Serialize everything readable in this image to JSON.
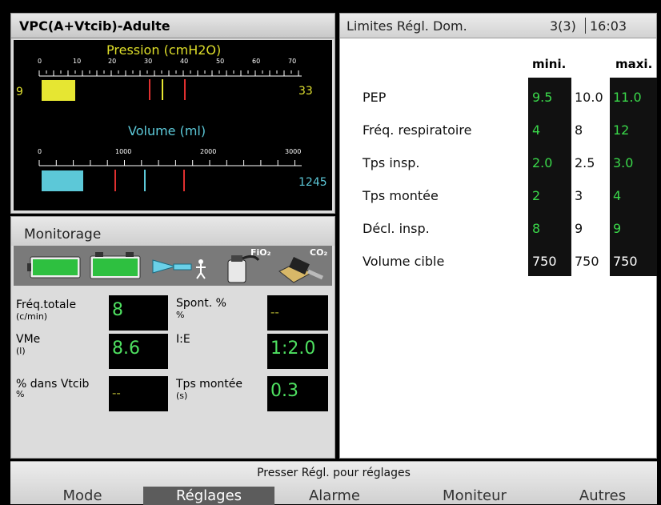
{
  "mode_panel": {
    "title": "VPC(A+Vtcib)-Adulte",
    "pressure": {
      "label": "Pression (cmH2O)",
      "ticks": [
        "0",
        "10",
        "20",
        "30",
        "40",
        "50",
        "60",
        "70"
      ],
      "bar_fill_value": 9,
      "left_value": "9",
      "right_value": "33"
    },
    "volume": {
      "label": "Volume (ml)",
      "ticks": [
        "0",
        "1000",
        "2000",
        "3000"
      ],
      "right_value": "1245"
    }
  },
  "monitorage": {
    "title": "Monitorage",
    "icons": [
      "battery-icon",
      "battery-icon",
      "patient-circuit-icon",
      "fio2-sensor-icon",
      "co2-sensor-icon"
    ],
    "icon_labels": {
      "fio2": "FiO₂",
      "co2": "CO₂"
    },
    "fields": [
      {
        "label": "Fréq.totale",
        "unit": "(c/min)",
        "value": "8"
      },
      {
        "label": "Spont. %",
        "unit": "%",
        "value": "--"
      },
      {
        "label": "VMe",
        "unit": "(l)",
        "value": "8.6"
      },
      {
        "label": "I:E",
        "unit": "",
        "value": "1:2.0"
      },
      {
        "label": "% dans Vtcib",
        "unit": "%",
        "value": "--"
      },
      {
        "label": "Tps montée",
        "unit": "(s)",
        "value": "0.3"
      }
    ]
  },
  "limits": {
    "title": "Limites Régl. Dom.",
    "page": "3(3)",
    "time": "16:03",
    "col_min": "mini.",
    "col_max": "maxi.",
    "rows": [
      {
        "label": "PEP",
        "min": "9.5",
        "cur": "10.0",
        "max": "11.0"
      },
      {
        "label": "Fréq. respiratoire",
        "min": "4",
        "cur": "8",
        "max": "12"
      },
      {
        "label": "Tps insp.",
        "min": "2.0",
        "cur": "2.5",
        "max": "3.0"
      },
      {
        "label": "Tps montée",
        "min": "2",
        "cur": "3",
        "max": "4"
      },
      {
        "label": "Décl. insp.",
        "min": "8",
        "cur": "9",
        "max": "9"
      },
      {
        "label": "Volume cible",
        "min": "750",
        "cur": "750",
        "max": "750"
      }
    ]
  },
  "bottom": {
    "hint": "Presser Régl. pour réglages",
    "tabs": [
      {
        "label": "Mode",
        "active": false
      },
      {
        "label": "Réglages",
        "active": true
      },
      {
        "label": "Alarme",
        "active": false
      },
      {
        "label": "Moniteur",
        "active": false
      },
      {
        "label": "Autres",
        "active": false
      }
    ]
  },
  "colors": {
    "green_value": "#3ad84a",
    "pressure_bar": "#e6e632",
    "volume_bar": "#5cc8d8",
    "limit_marker": "#e03030",
    "active_tab": "#5c5c5c"
  }
}
